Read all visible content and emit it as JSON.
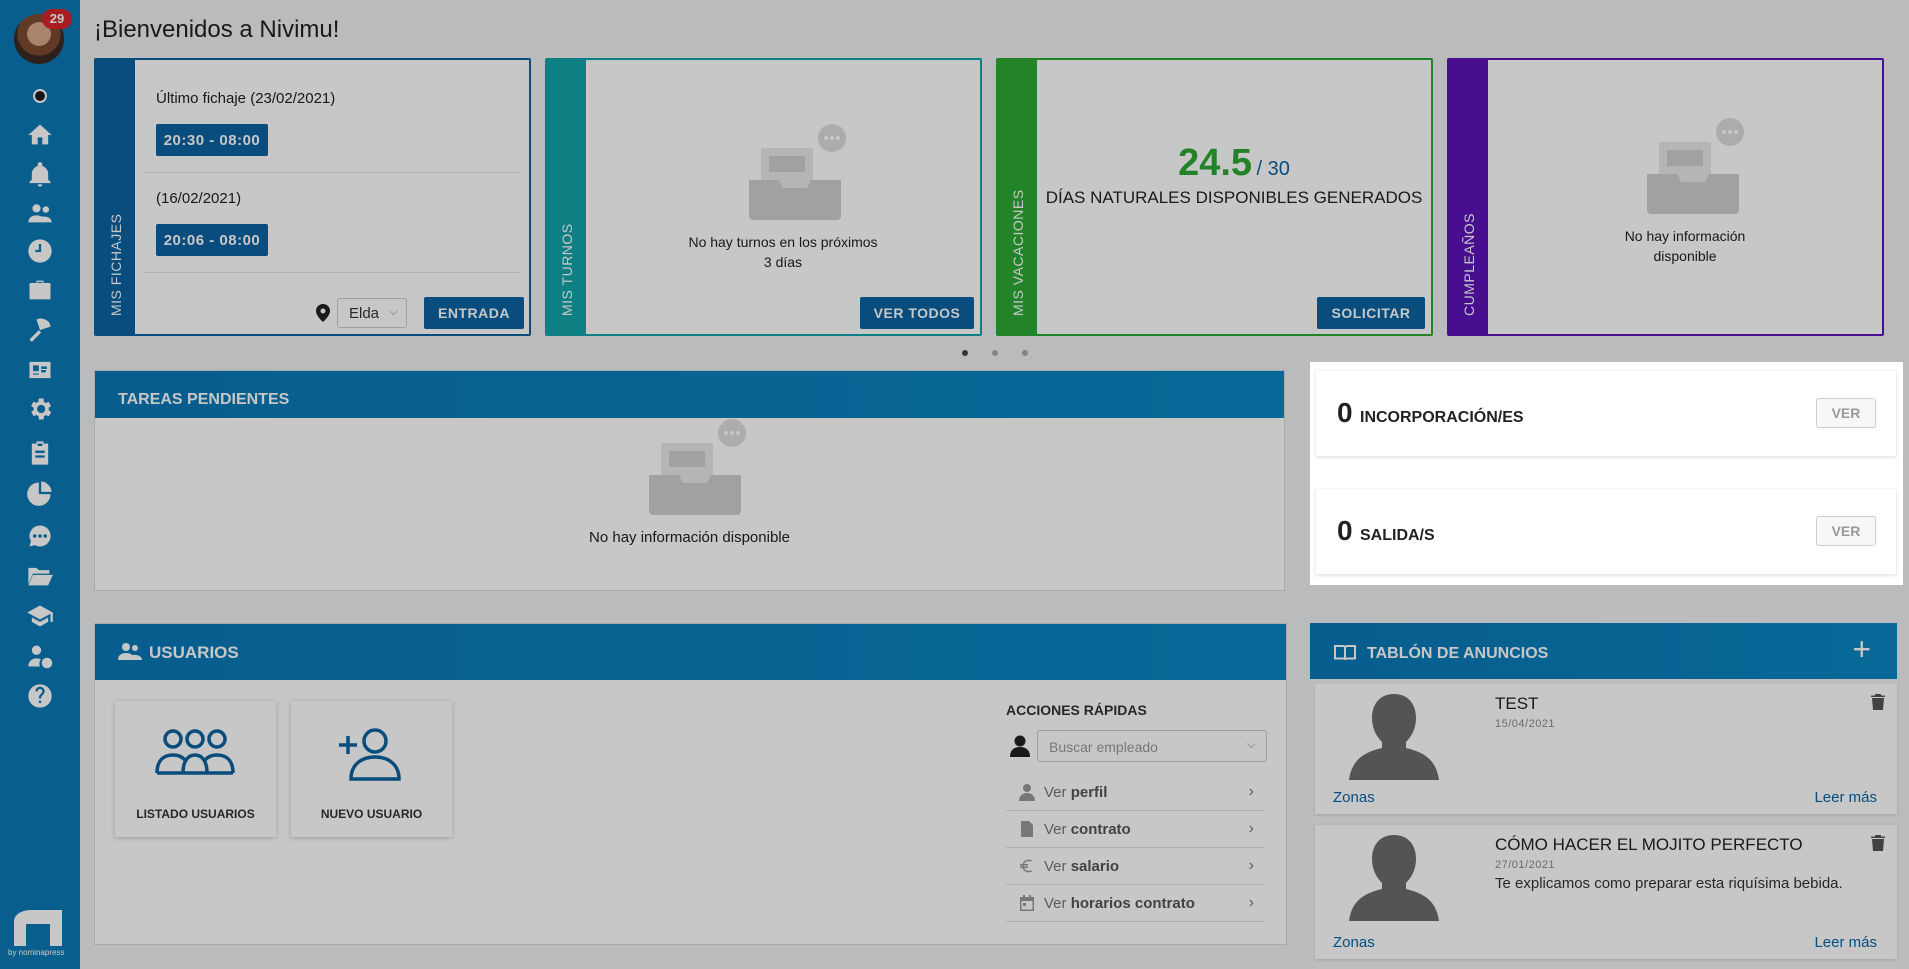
{
  "app": {
    "title": "¡Bienvenidos a Nivimu!",
    "badge_count": "29",
    "logo_text": "by nominapress"
  },
  "sidebar": {
    "items": [
      {
        "name": "home-icon"
      },
      {
        "name": "bell-icon"
      },
      {
        "name": "users-icon"
      },
      {
        "name": "clock-icon"
      },
      {
        "name": "briefcase-icon"
      },
      {
        "name": "umbrella-beach-icon"
      },
      {
        "name": "id-card-icon"
      },
      {
        "name": "gear-icon"
      },
      {
        "name": "clipboard-icon"
      },
      {
        "name": "pie-chart-icon"
      },
      {
        "name": "chat-icon"
      },
      {
        "name": "folder-open-icon"
      },
      {
        "name": "graduation-cap-icon"
      },
      {
        "name": "user-euro-icon"
      },
      {
        "name": "help-icon"
      }
    ]
  },
  "cards": {
    "fichajes": {
      "label": "MIS FICHAJES",
      "last_label": "Último fichaje (23/02/2021)",
      "last_time": "20:30 - 08:00",
      "prev_label": "(16/02/2021)",
      "prev_time": "20:06 - 08:00",
      "location": "Elda",
      "entrada": "ENTRADA",
      "color": "#0b63a1"
    },
    "turnos": {
      "label": "MIS TURNOS",
      "empty_line1": "No hay turnos en los próximos",
      "empty_line2": "3 días",
      "ver_todos": "VER TODOS",
      "color": "#12a3a8"
    },
    "vacaciones": {
      "label": "MIS VACACIONES",
      "available": "24.5",
      "total": "/ 30",
      "caption": "DÍAS NATURALES DISPONIBLES GENERADOS",
      "solicitar": "SOLICITAR",
      "color": "#2ea835"
    },
    "cumpleanos": {
      "label": "CUMPLEAÑOS",
      "empty_line1": "No hay información",
      "empty_line2": "disponible",
      "color": "#5b14b8"
    }
  },
  "tareas": {
    "title": "TAREAS PENDIENTES",
    "empty": "No hay información disponible"
  },
  "stats": {
    "incorporaciones": {
      "count": "0",
      "label": "INCORPORACIÓN/ES",
      "button": "VER"
    },
    "salidas": {
      "count": "0",
      "label": "SALIDA/S",
      "button": "VER"
    }
  },
  "usuarios": {
    "title": "USUARIOS",
    "tiles": [
      "LISTADO USUARIOS",
      "NUEVO USUARIO"
    ],
    "quick": {
      "title": "ACCIONES RÁPIDAS",
      "search_placeholder": "Buscar empleado",
      "rows": [
        {
          "prefix": "Ver",
          "bold": "perfil",
          "icon": "user-icon"
        },
        {
          "prefix": "Ver",
          "bold": "contrato",
          "icon": "document-icon"
        },
        {
          "prefix": "Ver",
          "bold": "salario",
          "icon": "euro-icon"
        },
        {
          "prefix": "Ver",
          "bold": "horarios contrato",
          "icon": "calendar-icon"
        }
      ]
    }
  },
  "tablon": {
    "title": "TABLÓN DE ANUNCIOS",
    "add": "+",
    "items": [
      {
        "title": "TEST",
        "date": "15/04/2021",
        "body": "",
        "zone": "Zonas",
        "more": "Leer más"
      },
      {
        "title": "CÓMO HACER EL MOJITO PERFECTO",
        "date": "27/01/2021",
        "body": "Te explicamos como preparar esta riquísima bebida.",
        "zone": "Zonas",
        "more": "Leer más"
      }
    ]
  }
}
